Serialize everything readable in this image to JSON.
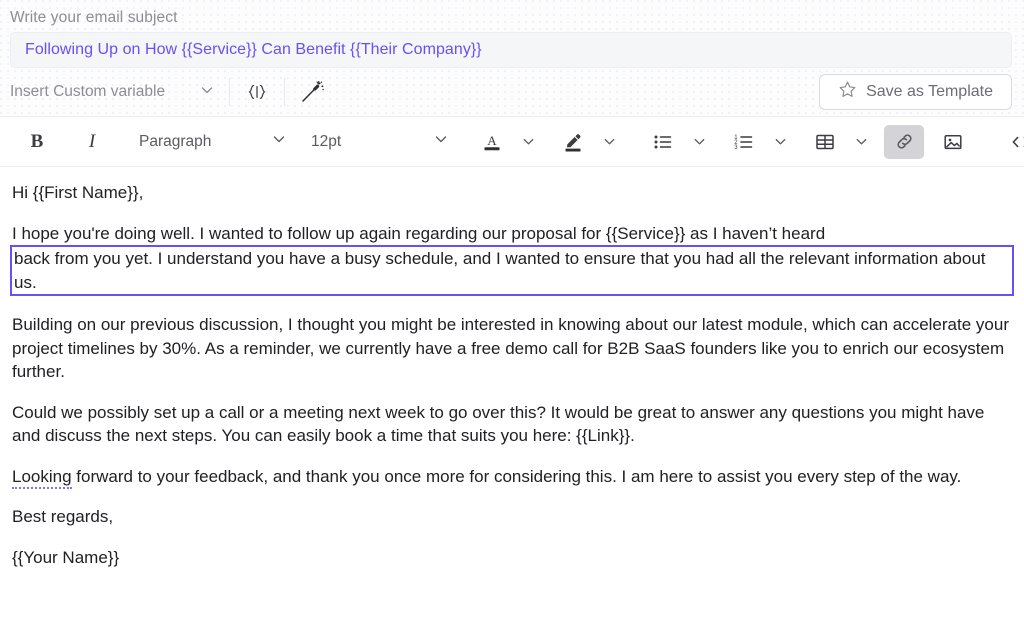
{
  "subject": {
    "label": "Write your email subject",
    "value": "Following Up on How {{Service}} Can Benefit {{Their Company}}",
    "placeholder": "Write your email subject"
  },
  "variable_bar": {
    "custom_variable_label": "Insert Custom variable",
    "chevron": "⌄",
    "braces_icon_label": "{ | }",
    "magic_icon_name": "magic-wand-icon",
    "save_template_label": "Save as Template",
    "star_icon_name": "star-icon"
  },
  "toolbar": {
    "bold_label": "B",
    "italic_label": "I",
    "paragraph_style": "Paragraph",
    "font_size": "12pt",
    "chevron": "⌄",
    "text_color_label": "A",
    "icons": {
      "text_color": "text-color-icon",
      "highlight": "highlight-pen-icon",
      "bulleted_list": "bulleted-list-icon",
      "numbered_list": "numbered-list-icon",
      "table": "table-icon",
      "link": "link-icon",
      "image": "image-icon",
      "code": "code-view-icon",
      "undo": "undo-icon"
    },
    "active_tool": "link"
  },
  "body": {
    "paragraphs": [
      {
        "id": "greeting",
        "text": "Hi {{First Name}},",
        "selected": false
      },
      {
        "id": "followup",
        "text": "I hope you're doing well. I wanted to follow up again regarding our proposal for {{Service}} as I haven’t heard",
        "selected": false
      },
      {
        "id": "selected-block",
        "text": "back from you yet. I understand you have a busy schedule, and I wanted to ensure that you had all the relevant information about us.",
        "selected": true
      },
      {
        "id": "module",
        "text": "Building on our previous discussion, I thought you might be interested in knowing about our latest module, which can accelerate your project timelines by 30%. As a reminder, we currently have a free demo call for B2B SaaS founders like you to enrich our ecosystem further.",
        "selected": false
      },
      {
        "id": "callrequest",
        "text": "Could we possibly set up a call or a meeting next week to go over this? It would be great to answer any questions you might have and discuss the next steps. You can easily book a time that suits you here: {{Link}}.",
        "selected": false
      },
      {
        "id": "closing-lead",
        "grammar_word": "Looking",
        "text": " forward to your feedback, and thank you once more for considering this. I am here to assist you every step of the way.",
        "selected": false
      },
      {
        "id": "signoff",
        "text": "Best regards,",
        "selected": false
      },
      {
        "id": "signature",
        "text": "{{Your Name}}",
        "selected": false
      }
    ]
  },
  "colors": {
    "accent_purple": "#6c4ef5",
    "grammar_underline": "#8b6df2",
    "muted_text": "#8d8d93",
    "border": "#e6e8ec",
    "active_tool_bg": "#d4d4d8"
  }
}
